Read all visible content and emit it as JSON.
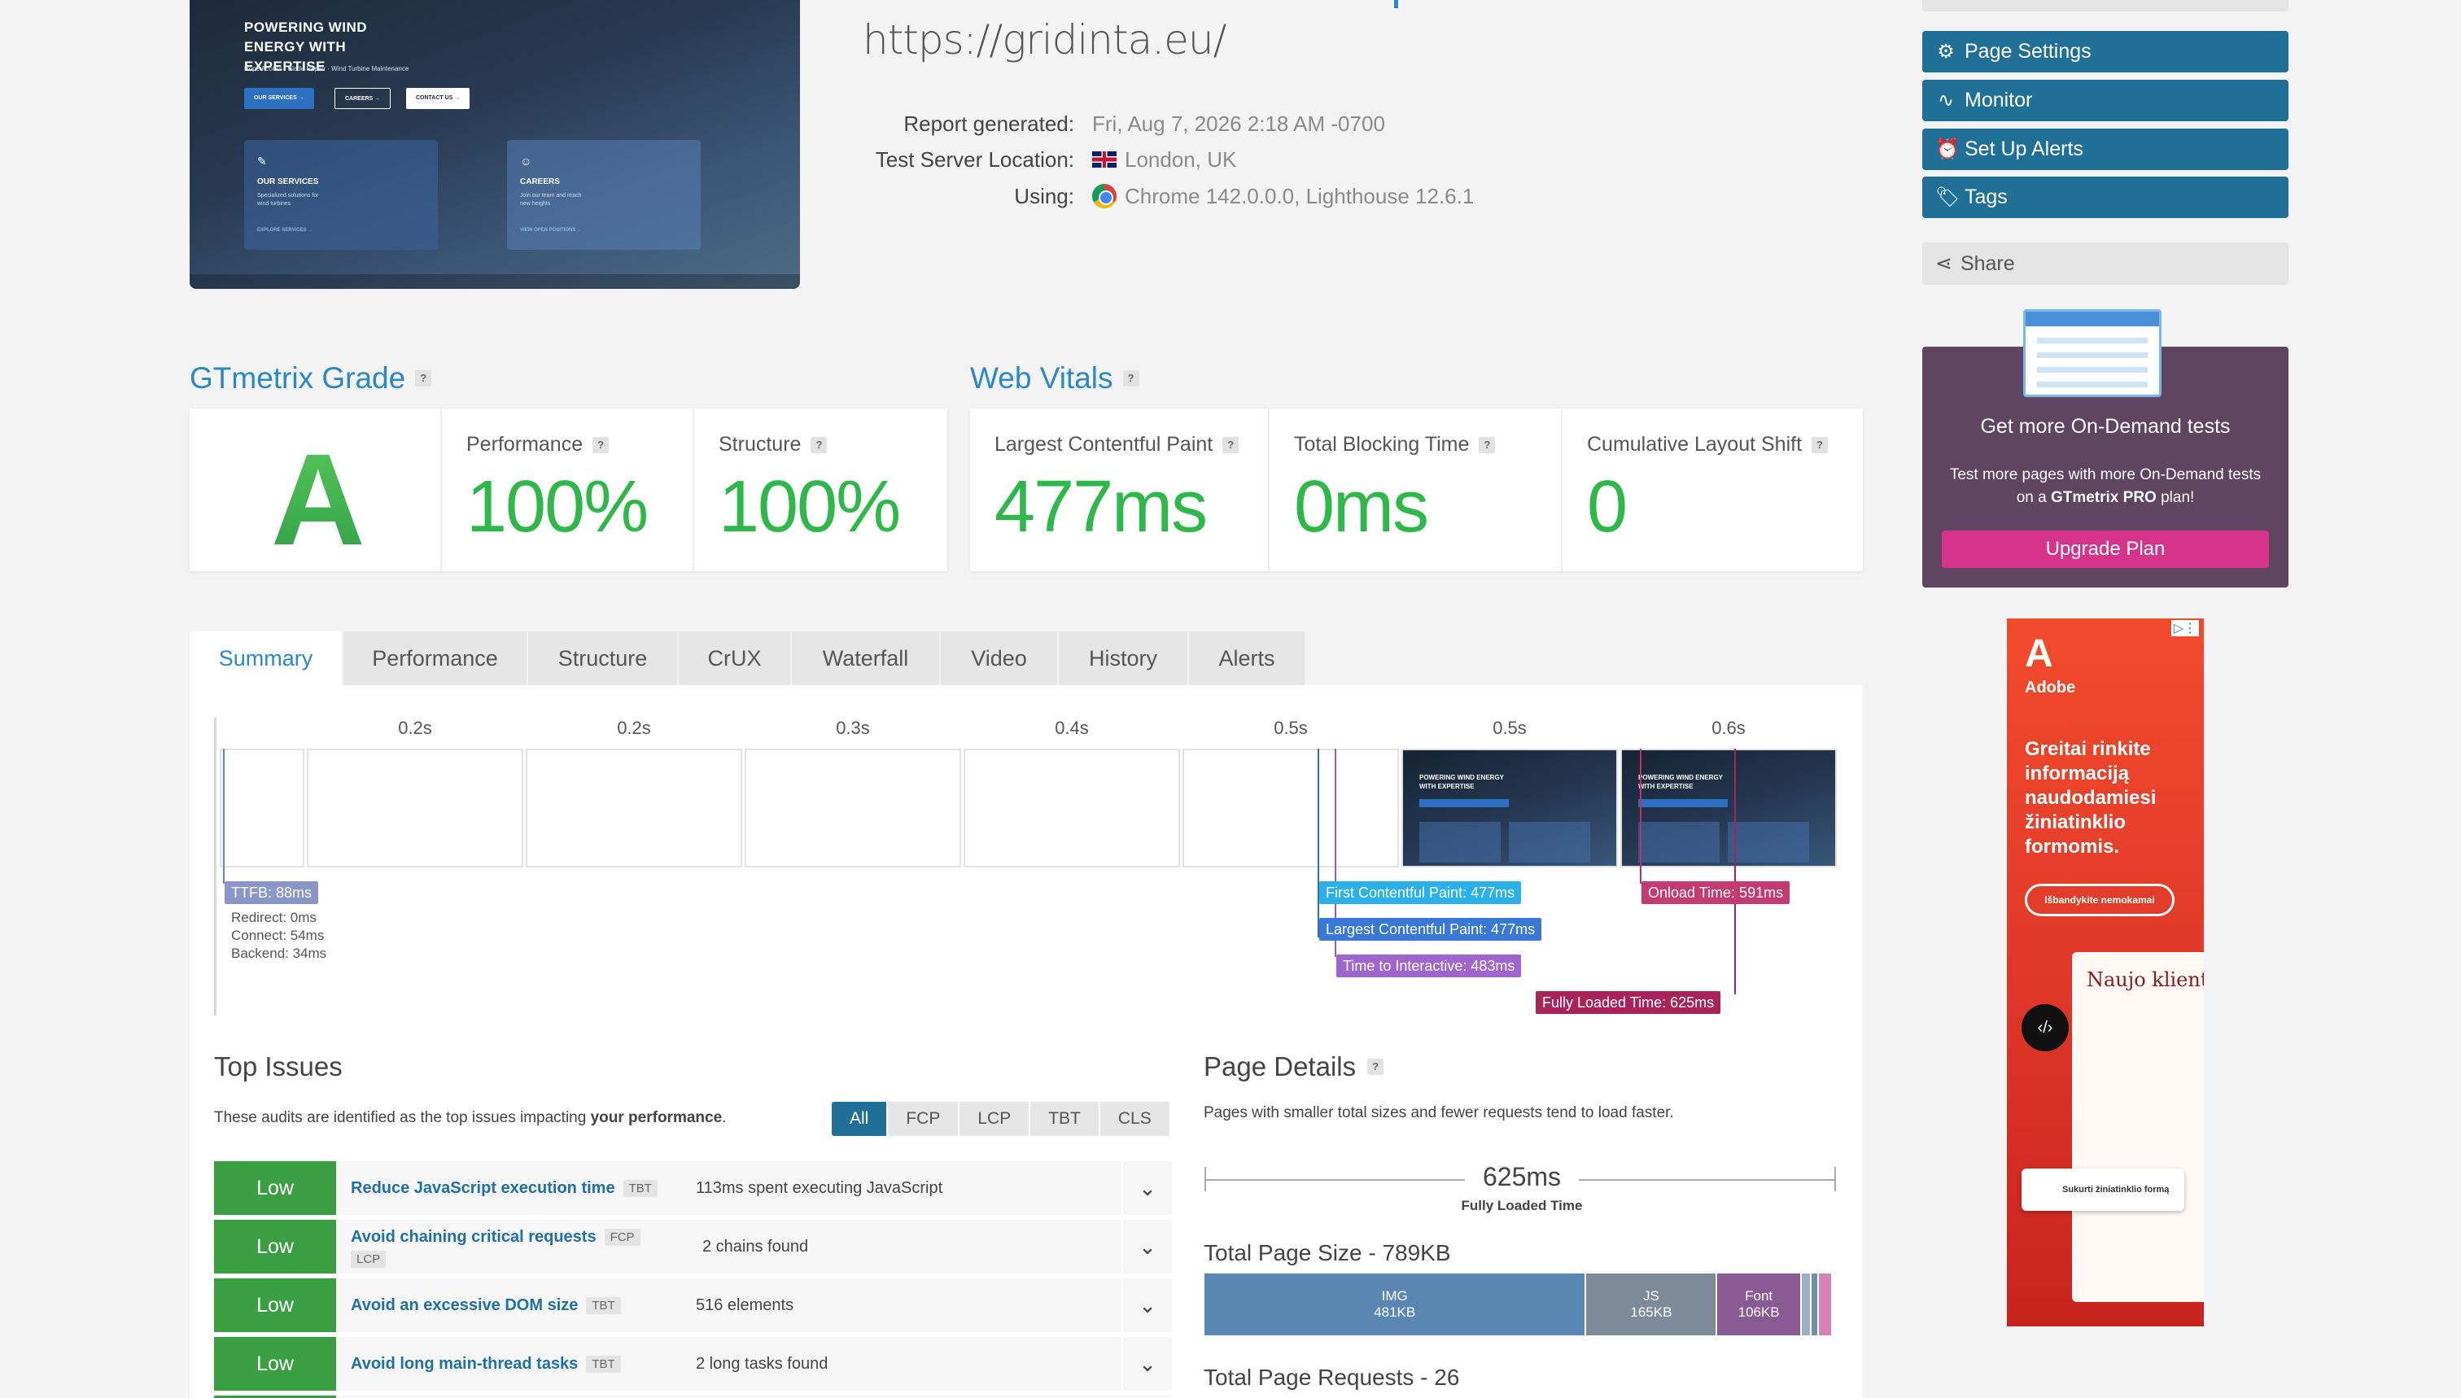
{
  "thumbnail": {
    "headline": "POWERING WIND ENERGY WITH EXPERTISE",
    "tagline": "Rope Access · Blade Repair · Wind Turbine Maintenance",
    "buttons": [
      "OUR SERVICES →",
      "CAREERS →",
      "CONTACT US →"
    ],
    "cards": [
      {
        "title": "OUR SERVICES",
        "text": "Specialized solutions for wind turbines",
        "link": "EXPLORE SERVICES →"
      },
      {
        "title": "CAREERS",
        "text": "Join our team and reach new heights",
        "link": "VIEW OPEN POSITIONS →"
      }
    ]
  },
  "header": {
    "url": "https://gridinta.eu/",
    "report_generated_label": "Report generated:",
    "report_generated_value": "Fri, Aug 7, 2026 2:18 AM -0700",
    "location_label": "Test Server Location:",
    "location_value": "London, UK",
    "using_label": "Using:",
    "using_value": "Chrome 142.0.0.0, Lighthouse 12.6.1"
  },
  "sidebar": {
    "buttons": [
      {
        "label": "Page Settings",
        "icon": "gear-icon"
      },
      {
        "label": "Monitor",
        "icon": "pulse-icon"
      },
      {
        "label": "Set Up Alerts",
        "icon": "alarm-icon"
      },
      {
        "label": "Tags",
        "icon": "tag-icon"
      }
    ],
    "share_label": "Share",
    "promo": {
      "heading": "Get more On-Demand tests",
      "text_pre": "Test more pages with more On-Demand tests on a ",
      "text_bold": "GTmetrix PRO",
      "text_post": " plan!",
      "button": "Upgrade Plan"
    },
    "ad": {
      "brand": "Adobe",
      "text": "Greitai rinkite informaciją naudodamiesi žiniatinklio formomis.",
      "cta": "Išbandykite nemokamai",
      "form_heading": "Naujo kliento",
      "chip": "Sukurti žiniatinklio formą"
    }
  },
  "grade": {
    "title": "GTmetrix Grade",
    "letter": "A",
    "performance_label": "Performance",
    "performance_value": "100%",
    "structure_label": "Structure",
    "structure_value": "100%"
  },
  "vitals": {
    "title": "Web Vitals",
    "lcp_label": "Largest Contentful Paint",
    "lcp_value": "477ms",
    "tbt_label": "Total Blocking Time",
    "tbt_value": "0ms",
    "cls_label": "Cumulative Layout Shift",
    "cls_value": "0"
  },
  "tabs": [
    "Summary",
    "Performance",
    "Structure",
    "CrUX",
    "Waterfall",
    "Video",
    "History",
    "Alerts"
  ],
  "timeline": {
    "frame_times": [
      "0.2s",
      "0.2s",
      "0.3s",
      "0.4s",
      "0.5s",
      "0.5s",
      "0.6s"
    ],
    "ttfb": "TTFB: 88ms",
    "redirect": "Redirect: 0ms",
    "connect": "Connect: 54ms",
    "backend": "Backend: 34ms",
    "fcp": "First Contentful Paint: 477ms",
    "lcp": "Largest Contentful Paint: 477ms",
    "tti": "Time to Interactive: 483ms",
    "onload": "Onload Time: 591ms",
    "fully_loaded": "Fully Loaded Time: 625ms"
  },
  "top_issues": {
    "title": "Top Issues",
    "desc_pre": "These audits are identified as the top issues impacting ",
    "desc_bold": "your performance",
    "desc_post": ".",
    "filters": [
      "All",
      "FCP",
      "LCP",
      "TBT",
      "CLS"
    ],
    "items": [
      {
        "severity": "Low",
        "name": "Reduce JavaScript execution time",
        "tags": [
          "TBT"
        ],
        "detail": "113ms spent executing JavaScript"
      },
      {
        "severity": "Low",
        "name": "Avoid chaining critical requests",
        "tags": [
          "FCP",
          "LCP"
        ],
        "detail": "2 chains found"
      },
      {
        "severity": "Low",
        "name": "Avoid an excessive DOM size",
        "tags": [
          "TBT"
        ],
        "detail": "516 elements"
      },
      {
        "severity": "Low",
        "name": "Avoid long main-thread tasks",
        "tags": [
          "TBT"
        ],
        "detail": "2 long tasks found"
      }
    ]
  },
  "page_details": {
    "title": "Page Details",
    "desc": "Pages with smaller total sizes and fewer requests tend to load faster.",
    "fully_loaded_value": "625ms",
    "fully_loaded_label": "Fully Loaded Time",
    "total_size_label": "Total Page Size - 789KB",
    "segments": [
      {
        "name": "IMG",
        "size": "481KB",
        "kb": 481,
        "color": "#5a86b3"
      },
      {
        "name": "JS",
        "size": "165KB",
        "kb": 165,
        "color": "#7c8a99"
      },
      {
        "name": "Font",
        "size": "106KB",
        "kb": 106,
        "color": "#8a5a94"
      },
      {
        "name": "",
        "size": "",
        "kb": 12,
        "color": "#9bb0c4"
      },
      {
        "name": "",
        "size": "",
        "kb": 10,
        "color": "#6f8fb0"
      },
      {
        "name": "",
        "size": "",
        "kb": 15,
        "color": "#d682b8"
      }
    ],
    "total_requests_label": "Total Page Requests - 26"
  }
}
